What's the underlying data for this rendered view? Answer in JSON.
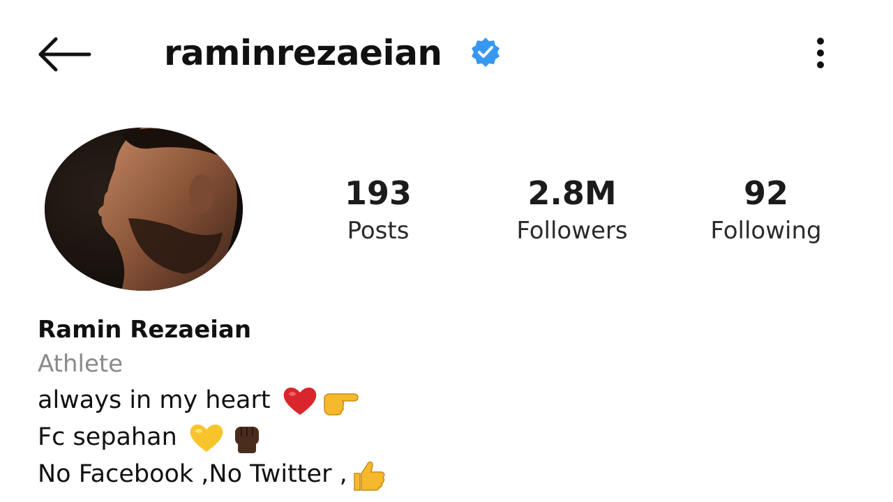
{
  "header": {
    "username": "raminrezaeian",
    "verified": true,
    "accent_color": "#3897f0"
  },
  "stats": [
    {
      "value": "193",
      "label": "Posts"
    },
    {
      "value": "2.8M",
      "label": "Followers"
    },
    {
      "value": "92",
      "label": "Following"
    }
  ],
  "bio": {
    "full_name": "Ramin Rezaeian",
    "category": "Athlete",
    "lines": [
      {
        "text": "always in my heart ",
        "emojis": [
          "red-heart",
          "pointing-right-hand"
        ]
      },
      {
        "text": "Fc sepahan ",
        "emojis": [
          "yellow-heart",
          "raised-fist-dark"
        ]
      },
      {
        "text": "No Facebook ,No Twitter ,",
        "emojis": [
          "thumbs-up"
        ]
      }
    ]
  },
  "icons": {
    "back": "arrow-left-icon",
    "more": "vertical-ellipsis-icon",
    "verified": "verified-badge-icon"
  }
}
